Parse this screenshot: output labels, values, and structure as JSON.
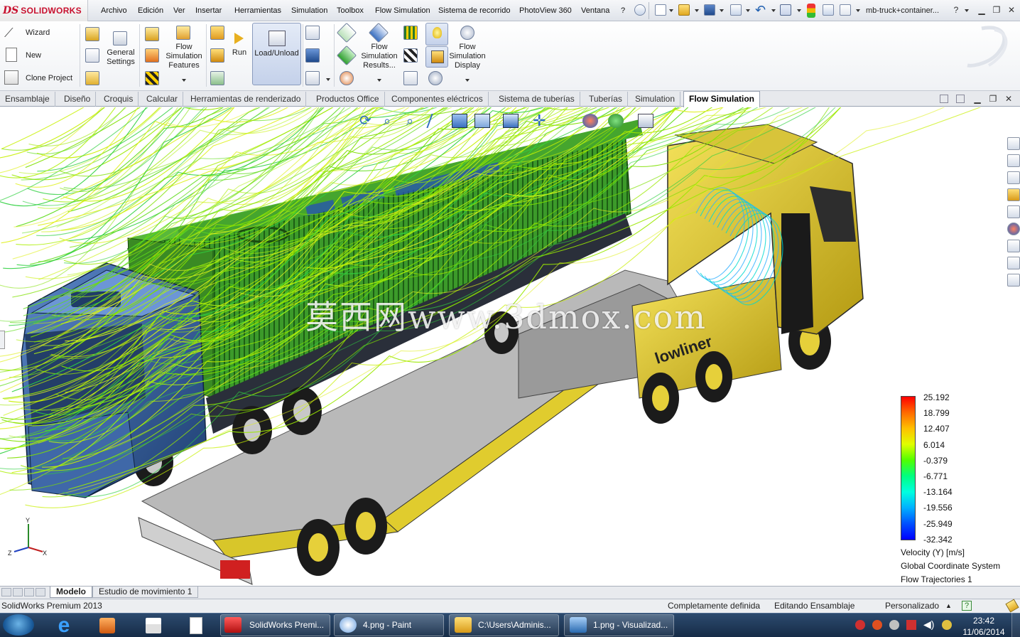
{
  "app": {
    "logo_mark": "DS",
    "logo_text": "SOLIDWORKS",
    "document_title": "mb-truck+container...",
    "help": "?"
  },
  "menu": [
    "Archivo",
    "Edición",
    "Ver",
    "Insertar",
    "Herramientas",
    "Simulation",
    "Toolbox",
    "Flow Simulation",
    "Sistema de recorrido",
    "PhotoView 360",
    "Ventana",
    "?"
  ],
  "ribbon": {
    "wizard": "Wizard",
    "new": "New",
    "clone": "Clone Project",
    "general_settings": [
      "General",
      "Settings"
    ],
    "features": [
      "Flow",
      "Simulation",
      "Features"
    ],
    "run": "Run",
    "load_unload": "Load/Unload",
    "results": [
      "Flow",
      "Simulation",
      "Results..."
    ],
    "display": [
      "Flow",
      "Simulation",
      "Display"
    ]
  },
  "tabs": [
    "Ensamblaje",
    "Diseño",
    "Croquis",
    "Calcular",
    "Herramientas de renderizado",
    "Productos Office",
    "Componentes eléctricos",
    "Sistema de tuberías",
    "Tuberías",
    "Simulation",
    "Flow Simulation"
  ],
  "active_tab": "Flow Simulation",
  "viewport": {
    "watermark": "莫西网www.3dmox.com",
    "trailer_brand": "lowliner",
    "axes": {
      "x": "X",
      "y": "Y",
      "z": "Z"
    }
  },
  "legend": {
    "values": [
      "25.192",
      "18.799",
      "12.407",
      "6.014",
      "-0.379",
      "-6.771",
      "-13.164",
      "-19.556",
      "-25.949",
      "-32.342"
    ],
    "quantity": "Velocity (Y) [m/s]",
    "system": "Global Coordinate System",
    "trajectories": "Flow Trajectories 1",
    "colors": [
      "#ff0000",
      "#ff6a00",
      "#ffc000",
      "#e0ff00",
      "#50ff00",
      "#00ff80",
      "#00ffe0",
      "#00b0ff",
      "#0050ff",
      "#0000ff"
    ]
  },
  "bottom_tabs": [
    "Modelo",
    "Estudio de movimiento 1"
  ],
  "status": {
    "product": "SolidWorks Premium 2013",
    "definition": "Completamente definida",
    "mode": "Editando Ensamblaje",
    "units": "Personalizado",
    "help": "?"
  },
  "taskbar": {
    "windows": [
      "SolidWorks Premi...",
      "4.png - Paint",
      "C:\\Users\\Adminis...",
      "1.png - Visualizad..."
    ],
    "time": "23:42",
    "date": "11/06/2014"
  }
}
